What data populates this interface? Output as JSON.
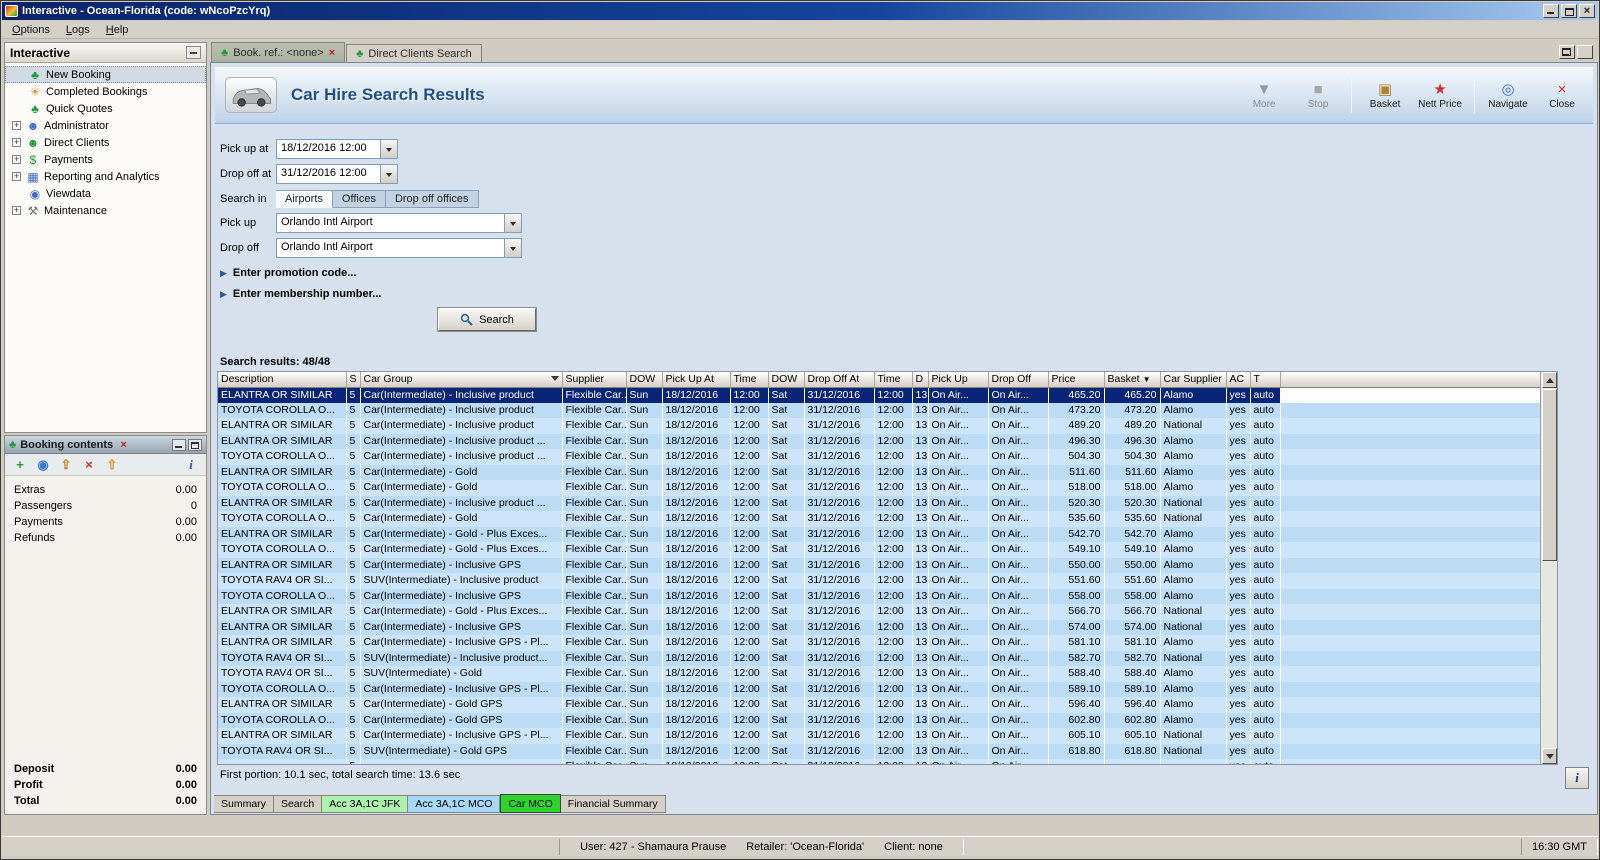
{
  "window": {
    "title": "Interactive - Ocean-Florida (code: wNcoPzcYrq)",
    "menu": [
      "Options",
      "Logs",
      "Help"
    ]
  },
  "sidebar": {
    "title": "Interactive",
    "items": [
      {
        "label": "New Booking",
        "icon": "palm-icon",
        "glyph": "♣",
        "color": "#1f9a3a",
        "selected": true
      },
      {
        "label": "Completed Bookings",
        "icon": "sun-icon",
        "glyph": "☀",
        "color": "#e09020"
      },
      {
        "label": "Quick Quotes",
        "icon": "palm-icon",
        "glyph": "♣",
        "color": "#1f9a3a"
      },
      {
        "label": "Administrator",
        "icon": "person-icon",
        "glyph": "☻",
        "color": "#3a6ad0",
        "expandable": true
      },
      {
        "label": "Direct Clients",
        "icon": "people-icon",
        "glyph": "☻",
        "color": "#1f9a3a",
        "expandable": true
      },
      {
        "label": "Payments",
        "icon": "payments-icon",
        "glyph": "$",
        "color": "#1f9a3a",
        "expandable": true
      },
      {
        "label": "Reporting and Analytics",
        "icon": "chart-icon",
        "glyph": "▦",
        "color": "#3a6ad0",
        "expandable": true
      },
      {
        "label": "Viewdata",
        "icon": "globe-icon",
        "glyph": "◉",
        "color": "#3a6ad0"
      },
      {
        "label": "Maintenance",
        "icon": "tools-icon",
        "glyph": "⚒",
        "color": "#6a7480",
        "expandable": true
      }
    ]
  },
  "booking_panel": {
    "title": "Booking contents",
    "toolbar": [
      {
        "icon": "add-icon",
        "glyph": "+",
        "color": "#1f9a3a"
      },
      {
        "icon": "globe-icon",
        "glyph": "◉",
        "color": "#3a7ad0"
      },
      {
        "icon": "export-icon",
        "glyph": "⇪",
        "color": "#c08820"
      },
      {
        "icon": "delete-icon",
        "glyph": "×",
        "color": "#d03030"
      },
      {
        "icon": "import-icon",
        "glyph": "⇧",
        "color": "#e09020"
      },
      {
        "icon": "info-icon",
        "glyph": "i",
        "color": "#2a50c0"
      }
    ],
    "rows": [
      {
        "label": "Extras",
        "value": "0.00"
      },
      {
        "label": "Passengers",
        "value": "0"
      },
      {
        "label": "Payments",
        "value": "0.00"
      },
      {
        "label": "Refunds",
        "value": "0.00"
      }
    ],
    "totals": [
      {
        "label": "Deposit",
        "value": "0.00"
      },
      {
        "label": "Profit",
        "value": "0.00"
      },
      {
        "label": "Total",
        "value": "0.00"
      }
    ]
  },
  "mdi_tabs": [
    {
      "label": "Book. ref.: <none>",
      "active": true,
      "closable": true
    },
    {
      "label": "Direct Clients Search"
    }
  ],
  "screen": {
    "title": "Car Hire Search Results",
    "toolbar": [
      {
        "name": "more-button",
        "label": "More",
        "icon": "more-icon",
        "glyph": "▼",
        "color": "#9a90b0",
        "disabled": true
      },
      {
        "name": "stop-button",
        "label": "Stop",
        "icon": "stop-icon",
        "glyph": "■",
        "color": "#a8a8a8",
        "disabled": true,
        "sep_after": true
      },
      {
        "name": "basket-button",
        "label": "Basket",
        "icon": "basket-icon",
        "glyph": "▣",
        "color": "#b08030"
      },
      {
        "name": "nett-price-button",
        "label": "Nett Price",
        "icon": "price-icon",
        "glyph": "★",
        "color": "#d03030",
        "sep_after": true
      },
      {
        "name": "navigate-button",
        "label": "Navigate",
        "icon": "navigate-icon",
        "glyph": "◎",
        "color": "#3a6ad0"
      },
      {
        "name": "close-button",
        "label": "Close",
        "icon": "close-icon",
        "glyph": "×",
        "color": "#d02020"
      }
    ],
    "form": {
      "pickup_at_label": "Pick up at",
      "pickup_at_value": "18/12/2016 12:00",
      "dropoff_at_label": "Drop off at",
      "dropoff_at_value": "31/12/2016 12:00",
      "search_in_label": "Search in",
      "search_in_tabs": [
        {
          "label": "Airports",
          "active": true
        },
        {
          "label": "Offices"
        },
        {
          "label": "Drop off offices"
        }
      ],
      "pickup_label": "Pick up",
      "pickup_value": "Orlando Intl Airport",
      "dropoff_label": "Drop off",
      "dropoff_value": "Orlando Intl Airport",
      "promo_toggle": "Enter promotion code...",
      "membership_toggle": "Enter membership number...",
      "search_button": "Search"
    },
    "results_label": "Search results: 48/48",
    "table": {
      "columns": [
        {
          "label": "Description"
        },
        {
          "label": "S"
        },
        {
          "label": "Car Group",
          "filter": true
        },
        {
          "label": "Supplier"
        },
        {
          "label": "DOW"
        },
        {
          "label": "Pick Up At"
        },
        {
          "label": "Time"
        },
        {
          "label": "DOW"
        },
        {
          "label": "Drop Off At"
        },
        {
          "label": "Time"
        },
        {
          "label": "D"
        },
        {
          "label": "Pick Up"
        },
        {
          "label": "Drop Off"
        },
        {
          "label": "Price"
        },
        {
          "label": "Basket",
          "sort": "desc"
        },
        {
          "label": "Car Supplier"
        },
        {
          "label": "AC"
        },
        {
          "label": "T"
        }
      ],
      "row_template": [
        "$0",
        "5",
        "$1",
        "Flexible Car...",
        "Sun",
        "18/12/2016",
        "12:00",
        "Sat",
        "31/12/2016",
        "12:00",
        "13",
        "On Air...",
        "On Air...",
        "$2",
        "$3",
        "$4",
        "yes",
        "auto"
      ],
      "rows": [
        {
          "v": [
            "ELANTRA OR SIMILAR",
            "Car(Intermediate) - Inclusive product",
            "465.20",
            "465.20",
            "Alamo"
          ],
          "selected": true
        },
        {
          "v": [
            "TOYOTA COROLLA O...",
            "Car(Intermediate) - Inclusive product",
            "473.20",
            "473.20",
            "Alamo"
          ]
        },
        {
          "v": [
            "ELANTRA OR SIMILAR",
            "Car(Intermediate) - Inclusive product",
            "489.20",
            "489.20",
            "National"
          ]
        },
        {
          "v": [
            "ELANTRA OR SIMILAR",
            "Car(Intermediate) - Inclusive product ...",
            "496.30",
            "496.30",
            "Alamo"
          ]
        },
        {
          "v": [
            "TOYOTA COROLLA O...",
            "Car(Intermediate) - Inclusive product ...",
            "504.30",
            "504.30",
            "Alamo"
          ]
        },
        {
          "v": [
            "ELANTRA OR SIMILAR",
            "Car(Intermediate) - Gold",
            "511.60",
            "511.60",
            "Alamo"
          ]
        },
        {
          "v": [
            "TOYOTA COROLLA O...",
            "Car(Intermediate) - Gold",
            "518.00",
            "518.00",
            "Alamo"
          ]
        },
        {
          "v": [
            "ELANTRA OR SIMILAR",
            "Car(Intermediate) - Inclusive product ...",
            "520.30",
            "520.30",
            "National"
          ]
        },
        {
          "v": [
            "TOYOTA COROLLA O...",
            "Car(Intermediate) - Gold",
            "535.60",
            "535.60",
            "National"
          ]
        },
        {
          "v": [
            "ELANTRA OR SIMILAR",
            "Car(Intermediate) - Gold - Plus Exces...",
            "542.70",
            "542.70",
            "Alamo"
          ]
        },
        {
          "v": [
            "TOYOTA COROLLA O...",
            "Car(Intermediate) - Gold - Plus Exces...",
            "549.10",
            "549.10",
            "Alamo"
          ]
        },
        {
          "v": [
            "ELANTRA OR SIMILAR",
            "Car(Intermediate) - Inclusive GPS",
            "550.00",
            "550.00",
            "Alamo"
          ]
        },
        {
          "v": [
            "TOYOTA RAV4 OR SI...",
            "SUV(Intermediate) - Inclusive product",
            "551.60",
            "551.60",
            "Alamo"
          ]
        },
        {
          "v": [
            "TOYOTA COROLLA O...",
            "Car(Intermediate) - Inclusive GPS",
            "558.00",
            "558.00",
            "Alamo"
          ]
        },
        {
          "v": [
            "ELANTRA OR SIMILAR",
            "Car(Intermediate) - Gold - Plus Exces...",
            "566.70",
            "566.70",
            "National"
          ]
        },
        {
          "v": [
            "ELANTRA OR SIMILAR",
            "Car(Intermediate) - Inclusive GPS",
            "574.00",
            "574.00",
            "National"
          ]
        },
        {
          "v": [
            "ELANTRA OR SIMILAR",
            "Car(Intermediate) - Inclusive GPS - Pl...",
            "581.10",
            "581.10",
            "Alamo"
          ]
        },
        {
          "v": [
            "TOYOTA RAV4 OR SI...",
            "SUV(Intermediate) - Inclusive product...",
            "582.70",
            "582.70",
            "National"
          ]
        },
        {
          "v": [
            "TOYOTA RAV4 OR SI...",
            "SUV(Intermediate) - Gold",
            "588.40",
            "588.40",
            "Alamo"
          ]
        },
        {
          "v": [
            "TOYOTA COROLLA O...",
            "Car(Intermediate) - Inclusive GPS - Pl...",
            "589.10",
            "589.10",
            "Alamo"
          ]
        },
        {
          "v": [
            "ELANTRA OR SIMILAR",
            "Car(Intermediate) - Gold GPS",
            "596.40",
            "596.40",
            "Alamo"
          ]
        },
        {
          "v": [
            "TOYOTA COROLLA O...",
            "Car(Intermediate) - Gold GPS",
            "602.80",
            "602.80",
            "Alamo"
          ]
        },
        {
          "v": [
            "ELANTRA OR SIMILAR",
            "Car(Intermediate) - Inclusive GPS - Pl...",
            "605.10",
            "605.10",
            "National"
          ]
        },
        {
          "v": [
            "TOYOTA RAV4 OR SI...",
            "SUV(Intermediate) - Gold GPS",
            "618.80",
            "618.80",
            "National"
          ]
        },
        {
          "v": [
            "",
            "",
            "",
            "",
            ""
          ],
          "partial": true
        }
      ]
    },
    "footer_status": "First portion: 10.1 sec, total search time: 13.6 sec",
    "bottom_tabs": [
      {
        "label": "Summary"
      },
      {
        "label": "Search"
      },
      {
        "label": "Acc 3A,1C JFK",
        "bg": "#aef0ae"
      },
      {
        "label": "Acc 3A,1C MCO",
        "bg": "#a8d8f8"
      },
      {
        "label": "Car MCO",
        "bg": "#2ed42e",
        "active": true
      },
      {
        "label": "Financial Summary"
      }
    ]
  },
  "statusbar": {
    "user": "User: 427 - Shamaura Prause",
    "retailer": "Retailer: 'Ocean-Florida'",
    "client": "Client: none",
    "time": "16:30 GMT"
  }
}
